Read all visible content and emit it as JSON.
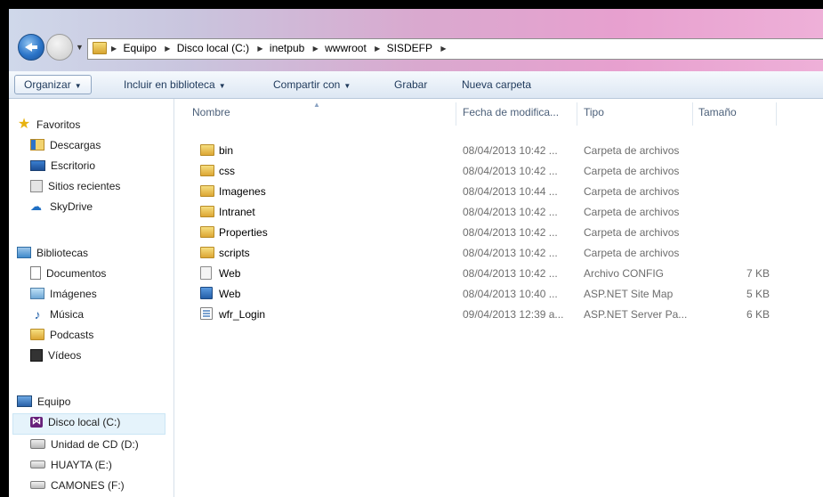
{
  "address": {
    "crumbs": [
      "Equipo",
      "Disco local (C:)",
      "inetpub",
      "wwwroot",
      "SISDEFP"
    ]
  },
  "toolbar": {
    "organizar": "Organizar",
    "incluir": "Incluir en biblioteca",
    "compartir": "Compartir con",
    "grabar": "Grabar",
    "nueva": "Nueva carpeta"
  },
  "sidebar": {
    "favoritos": "Favoritos",
    "descargas": "Descargas",
    "escritorio": "Escritorio",
    "sitios": "Sitios recientes",
    "skydrive": "SkyDrive",
    "bibliotecas": "Bibliotecas",
    "documentos": "Documentos",
    "imagenes": "Imágenes",
    "musica": "Música",
    "podcasts": "Podcasts",
    "videos": "Vídeos",
    "equipo": "Equipo",
    "disco_c": "Disco local (C:)",
    "cd_d": "Unidad de CD (D:)",
    "huayta": "HUAYTA (E:)",
    "camones": "CAMONES (F:)"
  },
  "columns": {
    "nombre": "Nombre",
    "fecha": "Fecha de modifica...",
    "tipo": "Tipo",
    "tamano": "Tamaño"
  },
  "files": [
    {
      "name": "bin",
      "date": "08/04/2013 10:42 ...",
      "type": "Carpeta de archivos",
      "size": ""
    },
    {
      "name": "css",
      "date": "08/04/2013 10:42 ...",
      "type": "Carpeta de archivos",
      "size": ""
    },
    {
      "name": "Imagenes",
      "date": "08/04/2013 10:44 ...",
      "type": "Carpeta de archivos",
      "size": ""
    },
    {
      "name": "Intranet",
      "date": "08/04/2013 10:42 ...",
      "type": "Carpeta de archivos",
      "size": ""
    },
    {
      "name": "Properties",
      "date": "08/04/2013 10:42 ...",
      "type": "Carpeta de archivos",
      "size": ""
    },
    {
      "name": "scripts",
      "date": "08/04/2013 10:42 ...",
      "type": "Carpeta de archivos",
      "size": ""
    },
    {
      "name": "Web",
      "date": "08/04/2013 10:42 ...",
      "type": "Archivo CONFIG",
      "size": "7 KB"
    },
    {
      "name": "Web",
      "date": "08/04/2013 10:40 ...",
      "type": "ASP.NET Site Map",
      "size": "5 KB"
    },
    {
      "name": "wfr_Login",
      "date": "09/04/2013 12:39 a...",
      "type": "ASP.NET Server Pa...",
      "size": "6 KB"
    }
  ]
}
